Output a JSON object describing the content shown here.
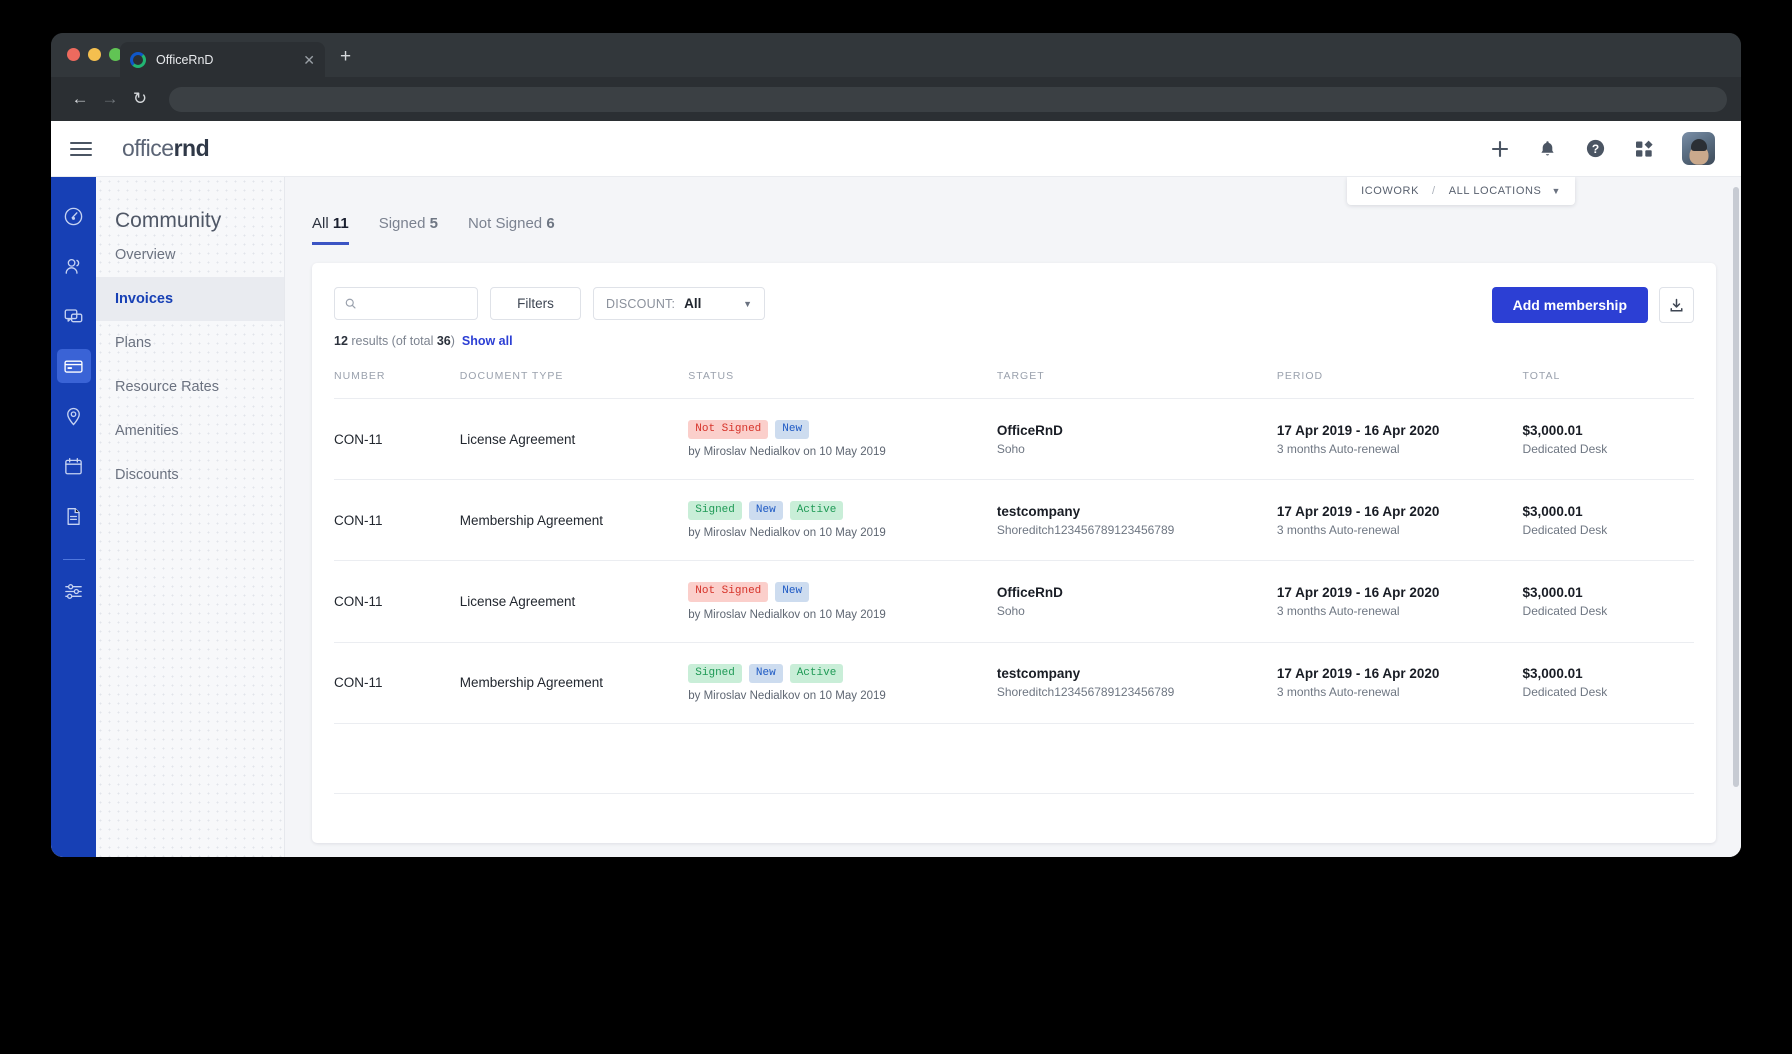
{
  "browser": {
    "tab_title": "OfficeRnD",
    "tab_close_icon": "close-icon",
    "new_tab_icon": "plus-icon",
    "back_icon": "arrow-left-icon",
    "forward_icon": "arrow-right-icon",
    "reload_icon": "reload-icon",
    "url_value": ""
  },
  "topbar": {
    "menu_icon": "hamburger-icon",
    "brand_light": "office",
    "brand_bold": "rnd",
    "actions": [
      {
        "name": "add-icon",
        "glyph": "+"
      },
      {
        "name": "notifications-bell-icon",
        "glyph": "bell"
      },
      {
        "name": "help-icon",
        "glyph": "?"
      },
      {
        "name": "apps-grid-icon",
        "glyph": "grid"
      }
    ],
    "avatar_name": "user-avatar"
  },
  "rail": {
    "items": [
      {
        "name": "dashboard-icon",
        "active": false
      },
      {
        "name": "members-icon",
        "active": false
      },
      {
        "name": "chat-icon",
        "active": false
      },
      {
        "name": "billing-card-icon",
        "active": true
      },
      {
        "name": "location-pin-icon",
        "active": false
      },
      {
        "name": "calendar-icon",
        "active": false
      },
      {
        "name": "reports-document-icon",
        "active": false
      },
      {
        "name": "settings-sliders-icon",
        "active": false
      }
    ]
  },
  "sidebar": {
    "title": "Community",
    "items": [
      {
        "label": "Overview",
        "active": false
      },
      {
        "label": "Invoices",
        "active": true
      },
      {
        "label": "Plans",
        "active": false
      },
      {
        "label": "Resource Rates",
        "active": false
      },
      {
        "label": "Amenities",
        "active": false
      },
      {
        "label": "Discounts",
        "active": false
      }
    ]
  },
  "location_selector": {
    "org": "ICOWORK",
    "separator": "/",
    "location": "ALL LOCATIONS",
    "chevron": "chevron-down-icon"
  },
  "tabs": [
    {
      "label": "All",
      "count": "11",
      "active": true
    },
    {
      "label": "Signed",
      "count": "5",
      "active": false
    },
    {
      "label": "Not Signed",
      "count": "6",
      "active": false
    }
  ],
  "toolbar": {
    "search_placeholder": "",
    "search_value": "",
    "search_icon": "search-icon",
    "filters_label": "Filters",
    "discount_label": "DISCOUNT:",
    "discount_value": "All",
    "discount_options": [
      "All"
    ],
    "add_membership_label": "Add membership",
    "export_icon": "download-icon"
  },
  "results": {
    "count": "12",
    "text_middle": " results (of total ",
    "total": "36",
    "text_end": ")",
    "show_all_label": "Show all"
  },
  "table": {
    "columns": [
      "NUMBER",
      "DOCUMENT TYPE",
      "STATUS",
      "TARGET",
      "PERIOD",
      "TOTAL"
    ],
    "rows": [
      {
        "number": "CON-11",
        "doctype": "License Agreement",
        "badges": [
          {
            "text": "Not Signed",
            "tone": "red"
          },
          {
            "text": "New",
            "tone": "blue"
          }
        ],
        "byline": "by Miroslav Nedialkov on 10 May 2019",
        "target_name": "OfficeRnD",
        "target_sub": "Soho",
        "period": "17 Apr 2019 - 16 Apr 2020",
        "period_sub": "3 months Auto-renewal",
        "total": "$3,000.01",
        "total_sub": "Dedicated Desk"
      },
      {
        "number": "CON-11",
        "doctype": "Membership Agreement",
        "badges": [
          {
            "text": "Signed",
            "tone": "green"
          },
          {
            "text": "New",
            "tone": "blue"
          },
          {
            "text": "Active",
            "tone": "green"
          }
        ],
        "byline": "by Miroslav Nedialkov on 10 May 2019",
        "target_name": "testcompany",
        "target_sub": "Shoreditch123456789123456789",
        "period": "17 Apr 2019 - 16 Apr 2020",
        "period_sub": "3 months Auto-renewal",
        "total": "$3,000.01",
        "total_sub": "Dedicated Desk"
      },
      {
        "number": "CON-11",
        "doctype": "License Agreement",
        "badges": [
          {
            "text": "Not Signed",
            "tone": "red"
          },
          {
            "text": "New",
            "tone": "blue"
          }
        ],
        "byline": "by Miroslav Nedialkov on 10 May 2019",
        "target_name": "OfficeRnD",
        "target_sub": "Soho",
        "period": "17 Apr 2019 - 16 Apr 2020",
        "period_sub": "3 months Auto-renewal",
        "total": "$3,000.01",
        "total_sub": "Dedicated Desk"
      },
      {
        "number": "CON-11",
        "doctype": "Membership Agreement",
        "badges": [
          {
            "text": "Signed",
            "tone": "green"
          },
          {
            "text": "New",
            "tone": "blue"
          },
          {
            "text": "Active",
            "tone": "green"
          }
        ],
        "byline": "by Miroslav Nedialkov on 10 May 2019",
        "target_name": "testcompany",
        "target_sub": "Shoreditch123456789123456789",
        "period": "17 Apr 2019 - 16 Apr 2020",
        "period_sub": "3 months Auto-renewal",
        "total": "$3,000.01",
        "total_sub": "Dedicated Desk"
      }
    ],
    "empty_rows": 2
  },
  "colors": {
    "brand_blue": "#1740b5",
    "primary_button": "#2c3fd4",
    "active_link": "#1740b5",
    "badge_red_bg": "#fbcfcb",
    "badge_red_text": "#d6332a",
    "badge_blue_bg": "#cddcef",
    "badge_blue_text": "#1d59c4",
    "badge_green_bg": "#c9eed8",
    "badge_green_text": "#1f9a56"
  }
}
